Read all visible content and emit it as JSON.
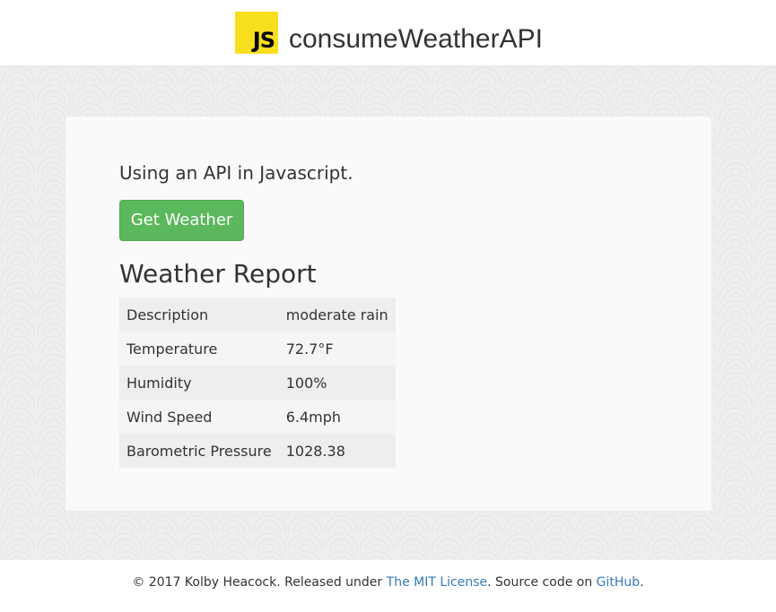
{
  "header": {
    "logo_text": "JS",
    "brand": "consumeWeatherAPI"
  },
  "main": {
    "lead": "Using an API in Javascript.",
    "get_weather_label": "Get Weather",
    "report_title": "Weather Report",
    "rows": [
      {
        "label": "Description",
        "value": "moderate rain"
      },
      {
        "label": "Temperature",
        "value": "72.7°F"
      },
      {
        "label": "Humidity",
        "value": "100%"
      },
      {
        "label": "Wind Speed",
        "value": "6.4mph"
      },
      {
        "label": "Barometric Pressure",
        "value": "1028.38"
      }
    ]
  },
  "footer": {
    "prefix": "© 2017 Kolby Heacock. Released under ",
    "license_link": "The MIT License",
    "middle": ". Source code on ",
    "github_link": "GitHub",
    "suffix": "."
  },
  "colors": {
    "accent_green": "#5cb85c",
    "link_blue": "#337ab7",
    "js_yellow": "#f7df1e"
  }
}
